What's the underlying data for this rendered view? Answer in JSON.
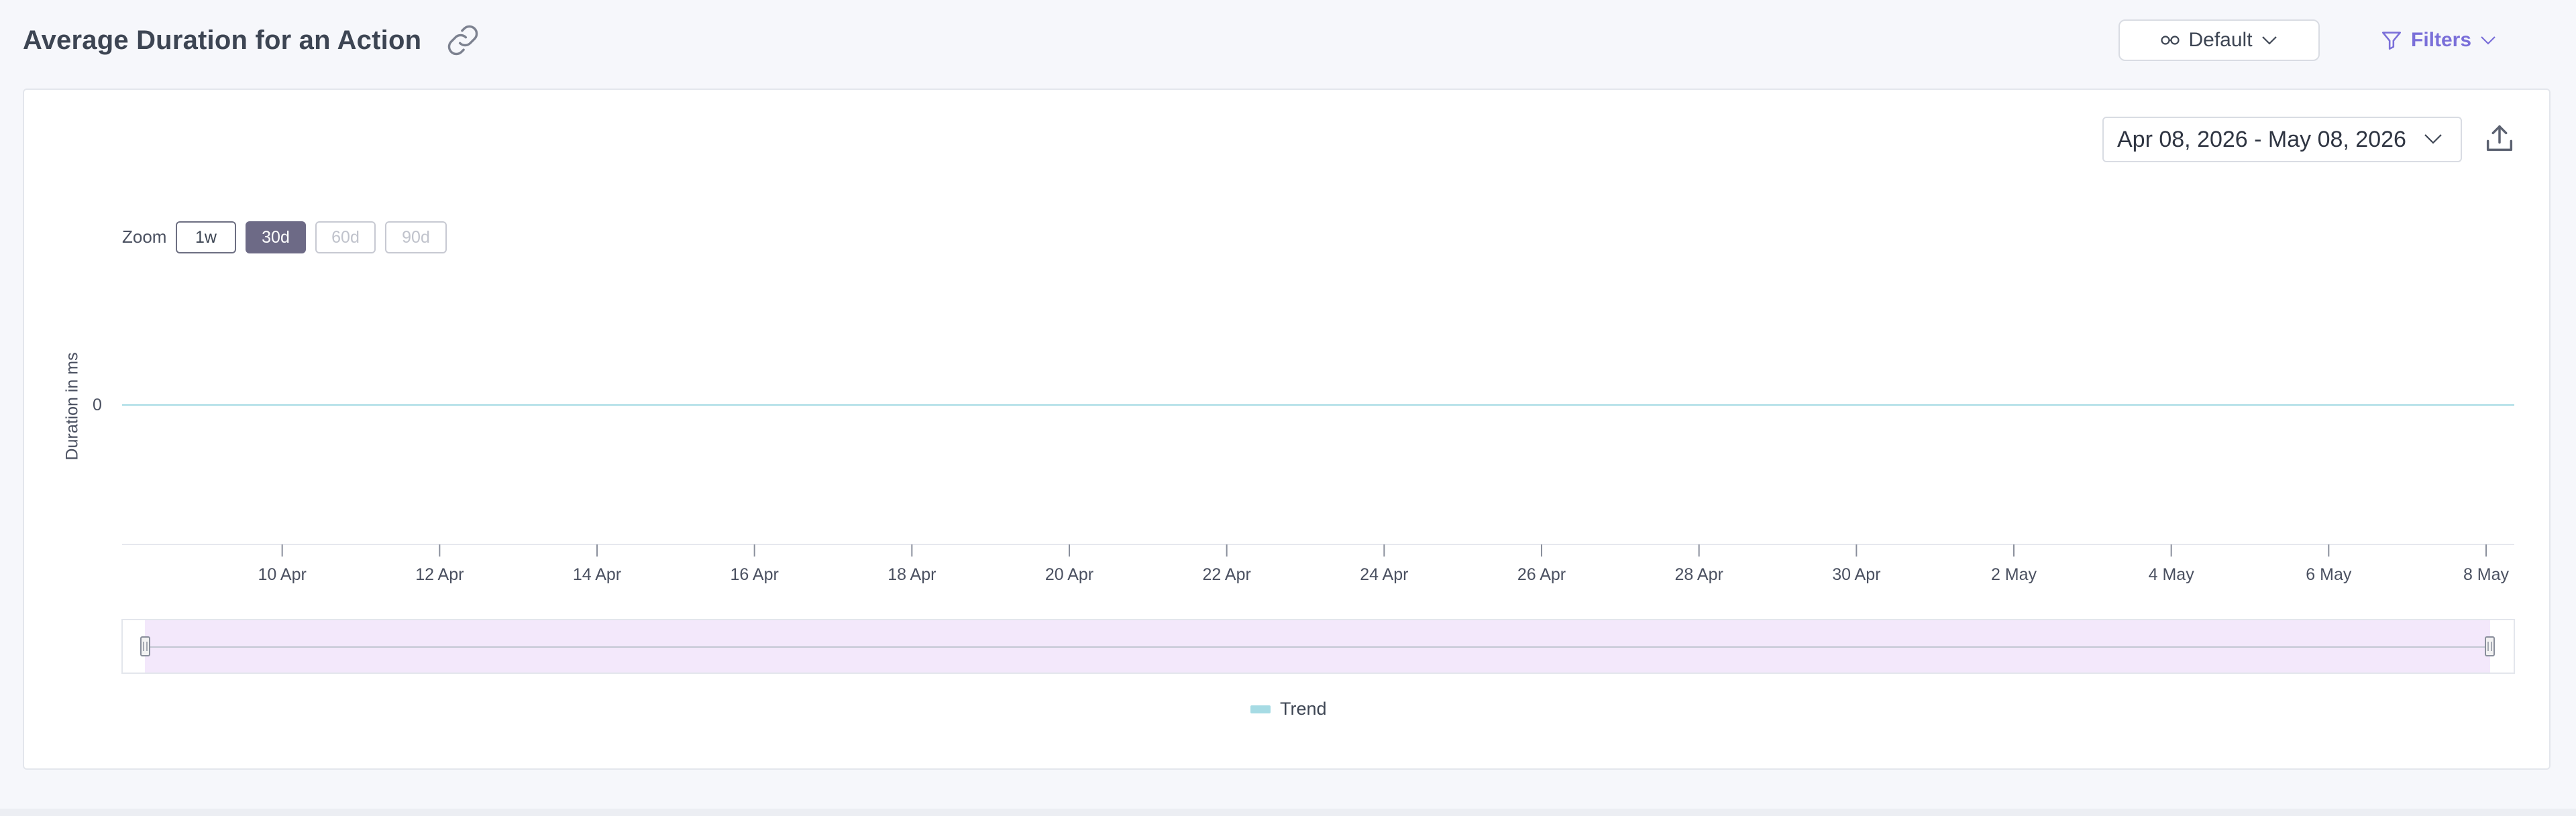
{
  "header": {
    "title": "Average Duration for an Action",
    "view_label": "Default",
    "filters_label": "Filters"
  },
  "toolbar": {
    "date_range": "Apr 08, 2026 - May 08, 2026"
  },
  "zoom": {
    "label": "Zoom",
    "options": [
      "1w",
      "30d",
      "60d",
      "90d"
    ],
    "selected": "30d",
    "disabled": [
      "60d",
      "90d"
    ]
  },
  "colors": {
    "accent": "#7a6fd9",
    "series_trend": "#a6dbe4",
    "navigator_fill": "#f3e8fb",
    "zoom_selected": "#6d6a86"
  },
  "icons": {
    "title_link": "link-icon",
    "view": "glasses-icon",
    "filters": "filter-icon",
    "export": "export-icon"
  },
  "chart_data": {
    "type": "line",
    "ylabel": "Duration in ms",
    "y_ticks": [
      "0"
    ],
    "x_tick_labels": [
      "10 Apr",
      "12 Apr",
      "14 Apr",
      "16 Apr",
      "18 Apr",
      "20 Apr",
      "22 Apr",
      "24 Apr",
      "26 Apr",
      "28 Apr",
      "30 Apr",
      "2 May",
      "4 May",
      "6 May",
      "8 May"
    ],
    "x_range": [
      "2026-04-08",
      "2026-05-08"
    ],
    "series": [
      {
        "name": "Trend",
        "x": [
          "2026-04-08",
          "2026-05-08"
        ],
        "values": [
          0,
          0
        ]
      }
    ],
    "legend_position": "bottom-center",
    "navigator": true,
    "grid": false
  }
}
